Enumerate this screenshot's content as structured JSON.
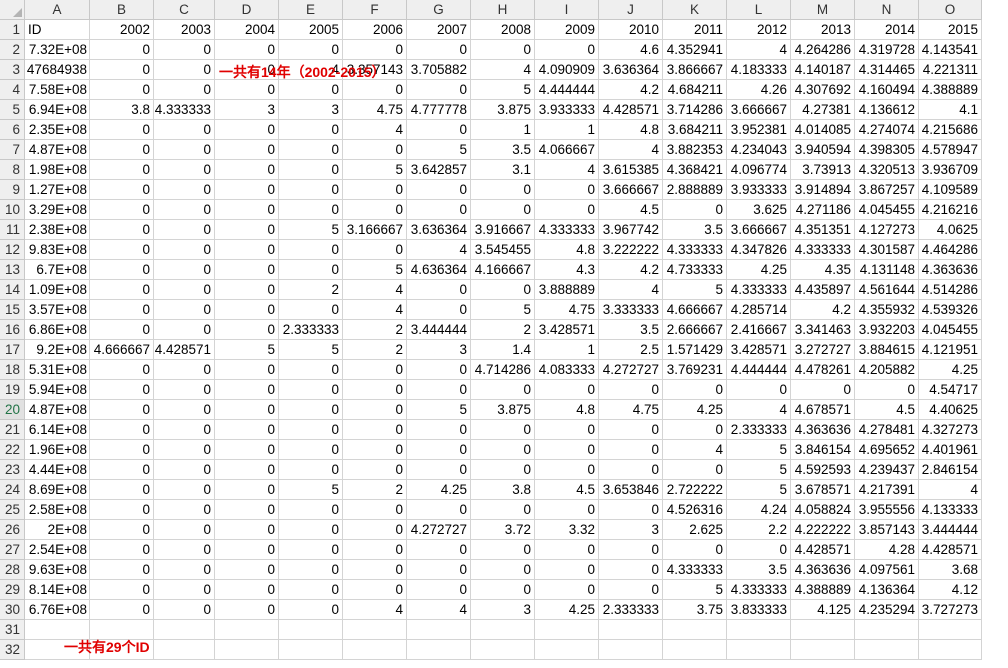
{
  "columns": [
    "A",
    "B",
    "C",
    "D",
    "E",
    "F",
    "G",
    "H",
    "I",
    "J",
    "K",
    "L",
    "M",
    "N",
    "O"
  ],
  "row_numbers": [
    1,
    2,
    3,
    4,
    5,
    6,
    7,
    8,
    9,
    10,
    11,
    12,
    13,
    14,
    15,
    16,
    17,
    18,
    19,
    20,
    21,
    22,
    23,
    24,
    25,
    26,
    27,
    28,
    29,
    30,
    31,
    32
  ],
  "selected_row": 20,
  "annotations": {
    "years_note": "一共有14年（2002-2015）",
    "ids_note": "一共有29个ID",
    "color": "#e00000"
  },
  "rows": [
    [
      "ID",
      "2002",
      "2003",
      "2004",
      "2005",
      "2006",
      "2007",
      "2008",
      "2009",
      "2010",
      "2011",
      "2012",
      "2013",
      "2014",
      "2015"
    ],
    [
      "7.32E+08",
      "0",
      "0",
      "0",
      "0",
      "0",
      "0",
      "0",
      "0",
      "4.6",
      "4.352941",
      "4",
      "4.264286",
      "4.319728",
      "4.143541"
    ],
    [
      "47684938",
      "0",
      "0",
      "0",
      "4",
      "3.357143",
      "3.705882",
      "4",
      "4.090909",
      "3.636364",
      "3.866667",
      "4.183333",
      "4.140187",
      "4.314465",
      "4.221311"
    ],
    [
      "7.58E+08",
      "0",
      "0",
      "0",
      "0",
      "0",
      "0",
      "5",
      "4.444444",
      "4.2",
      "4.684211",
      "4.26",
      "4.307692",
      "4.160494",
      "4.388889"
    ],
    [
      "6.94E+08",
      "3.8",
      "4.333333",
      "3",
      "3",
      "4.75",
      "4.777778",
      "3.875",
      "3.933333",
      "4.428571",
      "3.714286",
      "3.666667",
      "4.27381",
      "4.136612",
      "4.1"
    ],
    [
      "2.35E+08",
      "0",
      "0",
      "0",
      "0",
      "4",
      "0",
      "1",
      "1",
      "4.8",
      "3.684211",
      "3.952381",
      "4.014085",
      "4.274074",
      "4.215686"
    ],
    [
      "4.87E+08",
      "0",
      "0",
      "0",
      "0",
      "0",
      "5",
      "3.5",
      "4.066667",
      "4",
      "3.882353",
      "4.234043",
      "3.940594",
      "4.398305",
      "4.578947"
    ],
    [
      "1.98E+08",
      "0",
      "0",
      "0",
      "0",
      "5",
      "3.642857",
      "3.1",
      "4",
      "3.615385",
      "4.368421",
      "4.096774",
      "3.73913",
      "4.320513",
      "3.936709"
    ],
    [
      "1.27E+08",
      "0",
      "0",
      "0",
      "0",
      "0",
      "0",
      "0",
      "0",
      "3.666667",
      "2.888889",
      "3.933333",
      "3.914894",
      "3.867257",
      "4.109589"
    ],
    [
      "3.29E+08",
      "0",
      "0",
      "0",
      "0",
      "0",
      "0",
      "0",
      "0",
      "4.5",
      "0",
      "3.625",
      "4.271186",
      "4.045455",
      "4.216216"
    ],
    [
      "2.38E+08",
      "0",
      "0",
      "0",
      "5",
      "3.166667",
      "3.636364",
      "3.916667",
      "4.333333",
      "3.967742",
      "3.5",
      "3.666667",
      "4.351351",
      "4.127273",
      "4.0625"
    ],
    [
      "9.83E+08",
      "0",
      "0",
      "0",
      "0",
      "0",
      "4",
      "3.545455",
      "4.8",
      "3.222222",
      "4.333333",
      "4.347826",
      "4.333333",
      "4.301587",
      "4.464286"
    ],
    [
      "6.7E+08",
      "0",
      "0",
      "0",
      "0",
      "5",
      "4.636364",
      "4.166667",
      "4.3",
      "4.2",
      "4.733333",
      "4.25",
      "4.35",
      "4.131148",
      "4.363636"
    ],
    [
      "1.09E+08",
      "0",
      "0",
      "0",
      "2",
      "4",
      "0",
      "0",
      "3.888889",
      "4",
      "5",
      "4.333333",
      "4.435897",
      "4.561644",
      "4.514286"
    ],
    [
      "3.57E+08",
      "0",
      "0",
      "0",
      "0",
      "4",
      "0",
      "5",
      "4.75",
      "3.333333",
      "4.666667",
      "4.285714",
      "4.2",
      "4.355932",
      "4.539326"
    ],
    [
      "6.86E+08",
      "0",
      "0",
      "0",
      "2.333333",
      "2",
      "3.444444",
      "2",
      "3.428571",
      "3.5",
      "2.666667",
      "2.416667",
      "3.341463",
      "3.932203",
      "4.045455"
    ],
    [
      "9.2E+08",
      "4.666667",
      "4.428571",
      "5",
      "5",
      "2",
      "3",
      "1.4",
      "1",
      "2.5",
      "1.571429",
      "3.428571",
      "3.272727",
      "3.884615",
      "4.121951"
    ],
    [
      "5.31E+08",
      "0",
      "0",
      "0",
      "0",
      "0",
      "0",
      "4.714286",
      "4.083333",
      "4.272727",
      "3.769231",
      "4.444444",
      "4.478261",
      "4.205882",
      "4.25"
    ],
    [
      "5.94E+08",
      "0",
      "0",
      "0",
      "0",
      "0",
      "0",
      "0",
      "0",
      "0",
      "0",
      "0",
      "0",
      "0",
      "4.54717"
    ],
    [
      "4.87E+08",
      "0",
      "0",
      "0",
      "0",
      "0",
      "5",
      "3.875",
      "4.8",
      "4.75",
      "4.25",
      "4",
      "4.678571",
      "4.5",
      "4.40625"
    ],
    [
      "6.14E+08",
      "0",
      "0",
      "0",
      "0",
      "0",
      "0",
      "0",
      "0",
      "0",
      "0",
      "2.333333",
      "4.363636",
      "4.278481",
      "4.327273"
    ],
    [
      "1.96E+08",
      "0",
      "0",
      "0",
      "0",
      "0",
      "0",
      "0",
      "0",
      "0",
      "4",
      "5",
      "3.846154",
      "4.695652",
      "4.401961"
    ],
    [
      "4.44E+08",
      "0",
      "0",
      "0",
      "0",
      "0",
      "0",
      "0",
      "0",
      "0",
      "0",
      "5",
      "4.592593",
      "4.239437",
      "2.846154"
    ],
    [
      "8.69E+08",
      "0",
      "0",
      "0",
      "5",
      "2",
      "4.25",
      "3.8",
      "4.5",
      "3.653846",
      "2.722222",
      "5",
      "3.678571",
      "4.217391",
      "4"
    ],
    [
      "2.58E+08",
      "0",
      "0",
      "0",
      "0",
      "0",
      "0",
      "0",
      "0",
      "0",
      "4.526316",
      "4.24",
      "4.058824",
      "3.955556",
      "4.133333"
    ],
    [
      "2E+08",
      "0",
      "0",
      "0",
      "0",
      "0",
      "4.272727",
      "3.72",
      "3.32",
      "3",
      "2.625",
      "2.2",
      "4.222222",
      "3.857143",
      "3.444444"
    ],
    [
      "2.54E+08",
      "0",
      "0",
      "0",
      "0",
      "0",
      "0",
      "0",
      "0",
      "0",
      "0",
      "0",
      "4.428571",
      "4.28",
      "4.428571"
    ],
    [
      "9.63E+08",
      "0",
      "0",
      "0",
      "0",
      "0",
      "0",
      "0",
      "0",
      "0",
      "4.333333",
      "3.5",
      "4.363636",
      "4.097561",
      "3.68"
    ],
    [
      "8.14E+08",
      "0",
      "0",
      "0",
      "0",
      "0",
      "0",
      "0",
      "0",
      "0",
      "5",
      "4.333333",
      "4.388889",
      "4.136364",
      "4.12"
    ],
    [
      "6.76E+08",
      "0",
      "0",
      "0",
      "0",
      "4",
      "4",
      "3",
      "4.25",
      "2.333333",
      "3.75",
      "3.833333",
      "4.125",
      "4.235294",
      "3.727273"
    ],
    [
      "",
      "",
      "",
      "",
      "",
      "",
      "",
      "",
      "",
      "",
      "",
      "",
      "",
      "",
      ""
    ],
    [
      "",
      "",
      "",
      "",
      "",
      "",
      "",
      "",
      "",
      "",
      "",
      "",
      "",
      "",
      ""
    ]
  ]
}
